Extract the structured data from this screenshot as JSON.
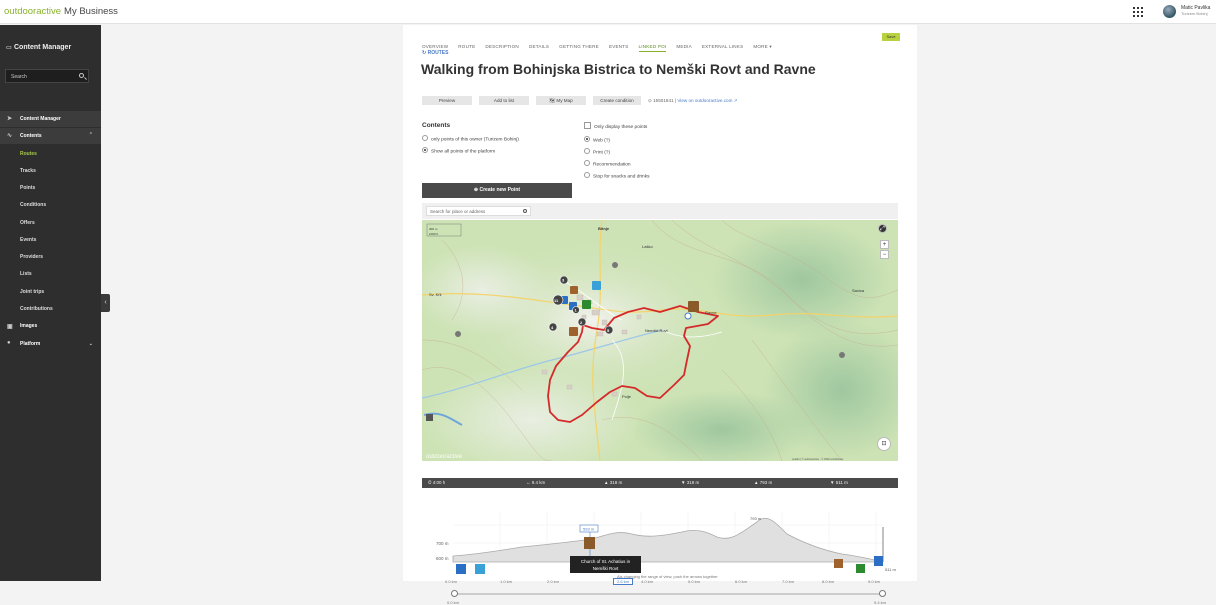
{
  "topbar": {
    "logo_brand": "outdooractive",
    "logo_product": "My Business",
    "apps_icon": "grid-icon",
    "user_name": "Matic Pavlika",
    "user_org": "Turizem Bohinj"
  },
  "sidebar": {
    "title": "Content Manager",
    "search_placeholder": "Search",
    "section_content_manager": "Content Manager",
    "section_contents": "Contents",
    "items": [
      "Routes",
      "Tracks",
      "Points",
      "Conditions",
      "Offers",
      "Events",
      "Providers",
      "Lists",
      "Joint trips",
      "Contributions"
    ],
    "active_item": "Routes",
    "section_images": "Images",
    "section_platform": "Platform",
    "collapse_glyph": "‹"
  },
  "tabs": [
    "OVERVIEW",
    "ROUTE",
    "DESCRIPTION",
    "DETAILS",
    "GETTING THERE",
    "EVENTS",
    "LINKED POI",
    "MEDIA",
    "EXTERNAL LINKS",
    "MORE ▾"
  ],
  "active_tab": "LINKED POI",
  "save_label": "Save",
  "breadcrumb": "↻ ROUTES",
  "title": "Walking from Bohinjska Bistrica to Nemški Rovt and Ravne",
  "actions": {
    "preview": "Preview",
    "add_to_list": "Add to list",
    "my_map": "🗺 My Map",
    "create_condition": "Create condition",
    "id_text": "⊙ 15501841 |",
    "view_link": "View on outdooractive.com ↗"
  },
  "contents": {
    "heading": "Contents",
    "owner_option": "only points of this owner (Turizem Bohinj)",
    "all_option": "Show all points of the platform",
    "only_display": "Only display these points",
    "web": "Web (?)",
    "print": "Print (?)",
    "recommendation": "Recommendation",
    "stop": "Stop for snacks and drinks"
  },
  "create_point_label": "⊕ Create new Point",
  "map": {
    "search_placeholder": "Search for place or address",
    "places": [
      "Bitnje",
      "Laško",
      "Sv. Křž",
      "Nemški Rovt",
      "Ravne",
      "Savica",
      "Polje"
    ],
    "scale": [
      "300 m",
      "1000 ft"
    ],
    "watermark": "outdooractive",
    "attribution": "Leaflet | © outdooractive · © OSM contributors",
    "route_color": "#d42a2a"
  },
  "stats": [
    "⏱ 4:00 h",
    "↔ 9.4 km",
    "▲ 318 m",
    "▼ 318 m",
    "▲ 793 m",
    "▼ 511 m"
  ],
  "profile": {
    "y_labels": [
      "700 m",
      "600 m"
    ],
    "x_labels": [
      "0.0 km",
      "1.0 km",
      "2.0 km",
      "3.0 km",
      "4.0 km",
      "5.0 km",
      "6.0 km",
      "7.0 km",
      "8.0 km",
      "9.0 km"
    ],
    "peak_label": "793 m",
    "right_label": "511 m",
    "marker_label": "593 m",
    "tooltip_line1": "Church of St. Achatius in",
    "tooltip_line2": "Nemški Rovt",
    "distance_label": "2.6 km",
    "slider_start": "0.0 km",
    "slider_end": "9.4 km",
    "slider_hint": "Als changing the range of view, push the arrows together"
  }
}
